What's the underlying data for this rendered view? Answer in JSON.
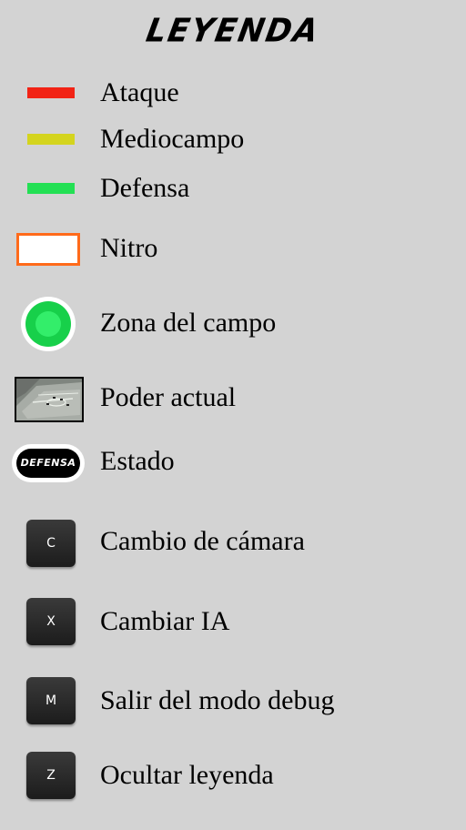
{
  "legend": {
    "title": "LEYENDA",
    "lines": [
      {
        "label": "Ataque",
        "color": "#f22315"
      },
      {
        "label": "Mediocampo",
        "color": "#d4d41e"
      },
      {
        "label": "Defensa",
        "color": "#23e054"
      }
    ],
    "nitro": {
      "label": "Nitro",
      "border_color": "#ff6a1a"
    },
    "zone": {
      "label": "Zona del campo",
      "color": "#17d04a"
    },
    "power": {
      "label": "Poder actual",
      "icon": "soccer-field-thumbnail"
    },
    "state": {
      "label": "Estado",
      "badge": "DEFENSA"
    },
    "controls": [
      {
        "key": "C",
        "label": "Cambio de cámara"
      },
      {
        "key": "X",
        "label": "Cambiar IA"
      },
      {
        "key": "M",
        "label": "Salir del modo debug"
      },
      {
        "key": "Z",
        "label": "Ocultar leyenda"
      }
    ]
  }
}
